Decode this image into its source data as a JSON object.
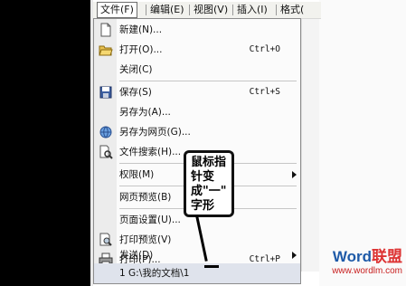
{
  "menubar": {
    "items": [
      {
        "label": "文件(F)"
      },
      {
        "label": "编辑(E)"
      },
      {
        "label": "视图(V)"
      },
      {
        "label": "插入(I)"
      },
      {
        "label": "格式("
      }
    ]
  },
  "menu": {
    "items": [
      {
        "label": "新建(N)...",
        "shortcut": "",
        "icon": "new-doc-icon"
      },
      {
        "label": "打开(O)...",
        "shortcut": "Ctrl+O",
        "icon": "open-folder-icon"
      },
      {
        "label": "关闭(C)",
        "shortcut": "",
        "icon": ""
      },
      {
        "label": "保存(S)",
        "shortcut": "Ctrl+S",
        "icon": "save-disk-icon"
      },
      {
        "label": "另存为(A)...",
        "shortcut": "",
        "icon": ""
      },
      {
        "label": "另存为网页(G)...",
        "shortcut": "",
        "icon": "save-web-icon"
      },
      {
        "label": "文件搜索(H)...",
        "shortcut": "",
        "icon": "search-file-icon"
      },
      {
        "label": "权限(M)",
        "shortcut": "",
        "icon": "",
        "submenu": true
      },
      {
        "label": "网页预览(B)",
        "shortcut": "",
        "icon": ""
      },
      {
        "label": "页面设置(U)...",
        "shortcut": "",
        "icon": ""
      },
      {
        "label": "打印预览(V)",
        "shortcut": "",
        "icon": "print-preview-icon"
      },
      {
        "label": "打印(P)...",
        "shortcut": "Ctrl+P",
        "icon": "print-icon"
      },
      {
        "label": "发送(D)",
        "shortcut": "",
        "icon": "",
        "submenu": true
      },
      {
        "label": "1 G:\\我的文档\\1",
        "shortcut": "",
        "icon": ""
      }
    ]
  },
  "callout": {
    "lines": [
      "鼠标指",
      "针变",
      "成\"一\"",
      "字形"
    ]
  },
  "watermark": {
    "brand_word": "Word",
    "brand_cn": "联盟",
    "url": "www.wordlm.com"
  },
  "colors": {
    "menubar_bg": "#f2f2ee",
    "menu_bg": "#fbfbfb",
    "watermark_red": "#d33333",
    "watermark_blue": "#1e5aa8"
  }
}
